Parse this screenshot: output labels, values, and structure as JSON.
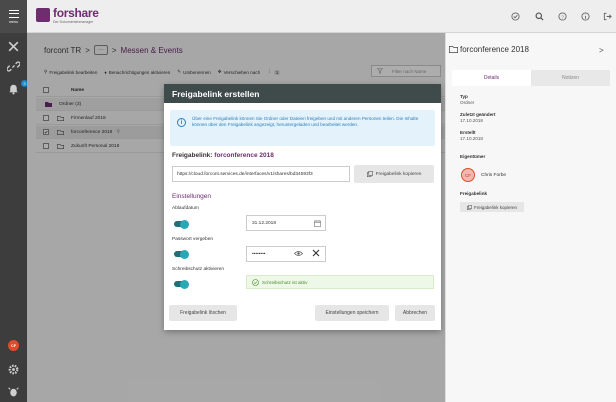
{
  "app": {
    "menu_label": "menu",
    "logo_name": "forshare",
    "logo_sub": "Der Dokumentenmanager"
  },
  "breadcrumb": {
    "root": "forcont TR",
    "sep1": ">",
    "more": "···",
    "sep2": ">",
    "current": "Messen & Events"
  },
  "toolbar": {
    "edit_link": "Freigabelink bearbeiten",
    "notifications": "Benachrichtigungen aktivieren",
    "rename": "Umbenennen",
    "move": "Verschieben nach",
    "more_count": "1"
  },
  "filter": {
    "placeholder": "Filter nach Name"
  },
  "list": {
    "header_name": "Name",
    "group": "Ordner (3)",
    "rows": [
      "Firmenlauf 2018",
      "forconference 2018",
      "Zukunft Personal 2018"
    ]
  },
  "rail": {
    "badge": "3",
    "avatar": "CF"
  },
  "dialog": {
    "title": "Freigabelink erstellen",
    "info": "Über eine Freigabelink können Sie Ordner oder Dateien freigeben und mit anderen Personen teilen. Die Inhalte können über den Freigabelink angezeigt, heruntergeladen und bearbeitet werden.",
    "link_label": "Freigabelink:",
    "link_name": "forconference 2018",
    "link_url": "https://cloud.forcont.services.de/interfaces/v1/shares/bd34593f3",
    "copy_button": "Freigabelink kopieren",
    "settings": "Einstellungen",
    "expiry_label": "Ablaufdatum",
    "expiry_value": "31.12.2018",
    "password_label": "Passwort vergeben",
    "password_value": "••••••••",
    "write_protect_label": "Schreibschutz aktivieren",
    "write_protect_note": "Schreibschutz ist aktiv",
    "delete_button": "Freigabelink löschen",
    "save_button": "Einstellungen speichern",
    "cancel_button": "Abbrechen"
  },
  "rpanel": {
    "title": "forconference 2018",
    "chevron": ">",
    "tab_details": "Details",
    "tab_notes": "Notizen",
    "type_k": "Typ",
    "type_v": "Ordner",
    "modified_k": "Zuletzt geändert",
    "modified_v": "17.10.2018",
    "created_k": "Erstellt",
    "created_v": "17.10.2018",
    "owner_k": "Eigentümer",
    "owner_initials": "CF",
    "owner_name": "Chris Forbe",
    "link_k": "Freigabelink",
    "copy_button": "Freigabelink kopieren"
  },
  "colors": {
    "brand": "#6d2d6e",
    "accent": "#2aa7b5",
    "dialog_header": "#3f4a4b",
    "info": "#2a7fc0",
    "success": "#4a8c2a"
  }
}
